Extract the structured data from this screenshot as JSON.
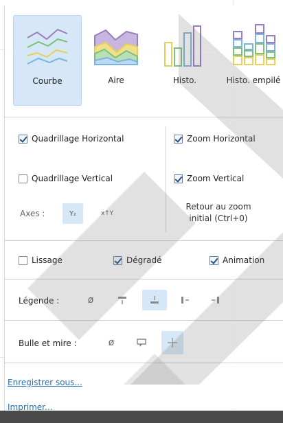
{
  "chart_types": [
    {
      "label": "Courbe",
      "active": true,
      "icon": "line-chart-icon"
    },
    {
      "label": "Aire",
      "active": false,
      "icon": "area-chart-icon"
    },
    {
      "label": "Histo.",
      "active": false,
      "icon": "bar-chart-icon"
    },
    {
      "label": "Histo. empilé",
      "active": false,
      "icon": "stacked-bar-chart-icon"
    }
  ],
  "grid": {
    "horizontal": {
      "label": "Quadrillage Horizontal",
      "checked": true
    },
    "vertical": {
      "label": "Quadrillage Vertical",
      "checked": false
    }
  },
  "zoom": {
    "horizontal": {
      "label": "Zoom Horizontal",
      "checked": true
    },
    "vertical": {
      "label": "Zoom Vertical",
      "checked": true
    },
    "reset_line1": "Retour au zoom",
    "reset_line2": "initial (Ctrl+0)"
  },
  "axes": {
    "label": "Axes :",
    "icons": [
      "swap-axes-icon",
      "axis-xy-icon"
    ],
    "icon1_text": "Y₂",
    "icon2_text": "x↑Y"
  },
  "options": {
    "smoothing": {
      "label": "Lissage",
      "checked": false
    },
    "gradient": {
      "label": "Dégradé",
      "checked": true
    },
    "animation": {
      "label": "Animation",
      "checked": true
    }
  },
  "legend": {
    "label": "Légende :",
    "icons": [
      "no-legend-icon",
      "legend-top-icon",
      "legend-bottom-icon",
      "legend-left-icon",
      "legend-right-icon"
    ],
    "active_index": 2
  },
  "tooltip": {
    "label": "Bulle et mire :",
    "icons": [
      "no-tooltip-icon",
      "tooltip-bubble-icon",
      "crosshair-icon"
    ],
    "active_index": 2
  },
  "links": {
    "save_as": "Enregistrer sous...",
    "print": "Imprimer..."
  },
  "colors": {
    "active_bg": "#d6e8f7",
    "link": "#2a6fb0",
    "series_green": "#7cc07a",
    "series_purple": "#9a7cc0",
    "series_yellow": "#e7cf5a",
    "series_blue": "#7ab3e0"
  }
}
